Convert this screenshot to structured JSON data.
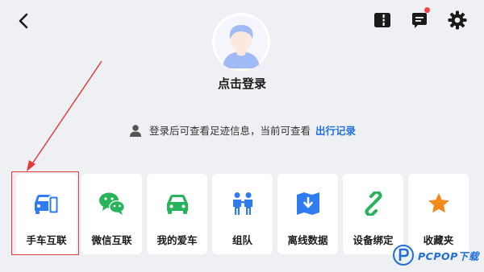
{
  "header": {
    "back_icon": "chevron-left-icon",
    "split_icon": "split-screen-icon",
    "message_icon": "message-icon",
    "settings_icon": "gear-icon",
    "badge_color": "#f2424b"
  },
  "profile": {
    "avatar_icon": "default-avatar-icon",
    "avatar_color": "#9fbaf4",
    "login_label": "点击登录"
  },
  "notice": {
    "icon": "user-icon",
    "text": "登录后可查看足迹信息，当前可查看",
    "link_text": "出行记录",
    "link_color": "#1f6fe0"
  },
  "features": [
    {
      "label": "手车互联",
      "icon": "phone-car-icon",
      "color": "#2f7cf0"
    },
    {
      "label": "微信互联",
      "icon": "wechat-icon",
      "color": "#27b35a"
    },
    {
      "label": "我的爱车",
      "icon": "car-icon",
      "color": "#27b35a"
    },
    {
      "label": "组队",
      "icon": "team-icon",
      "color": "#2f7cf0"
    },
    {
      "label": "离线数据",
      "icon": "offline-map-icon",
      "color": "#2f7cf0"
    },
    {
      "label": "设备绑定",
      "icon": "link-icon",
      "color": "#27b35a"
    },
    {
      "label": "收藏夹",
      "icon": "star-icon",
      "color": "#f08a1c"
    }
  ],
  "annotation": {
    "color": "#e33b3b"
  },
  "watermark": {
    "text": "PCPOP下载",
    "color": "#1f6fd6"
  }
}
